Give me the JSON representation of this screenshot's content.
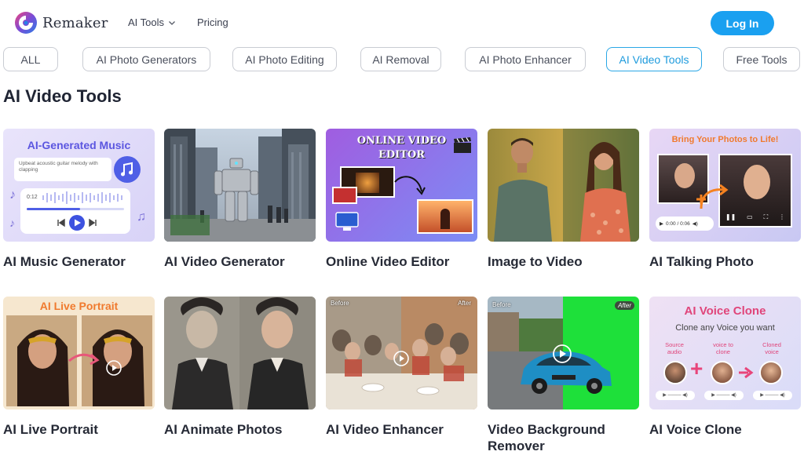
{
  "header": {
    "brand": "Remaker",
    "nav": [
      {
        "label": "AI Tools",
        "has_dropdown": true
      },
      {
        "label": "Pricing",
        "has_dropdown": false
      }
    ],
    "login_label": "Log In",
    "accent": "#1aa0f0"
  },
  "categories": [
    {
      "label": "ALL",
      "active": false
    },
    {
      "label": "AI Photo Generators",
      "active": false
    },
    {
      "label": "AI Photo Editing",
      "active": false
    },
    {
      "label": "AI Removal",
      "active": false
    },
    {
      "label": "AI Photo Enhancer",
      "active": false
    },
    {
      "label": "AI Video Tools",
      "active": true
    },
    {
      "label": "Free Tools",
      "active": false
    }
  ],
  "section_title": "AI Video Tools",
  "cards": [
    {
      "title": "AI Music Generator",
      "overlay": {
        "headline": "AI-Generated Music",
        "prompt": "Upbeat acoustic guitar melody with clapping",
        "time": "0:12"
      }
    },
    {
      "title": "AI Video Generator"
    },
    {
      "title": "Online Video Editor",
      "overlay": {
        "headline_line1": "ONLINE VIDEO",
        "headline_line2": "EDITOR"
      }
    },
    {
      "title": "Image to Video"
    },
    {
      "title": "AI Talking Photo",
      "overlay": {
        "headline": "Bring Your Photos to Life!",
        "time": "0:00 / 0:06"
      }
    },
    {
      "title": "AI Live Portrait",
      "overlay": {
        "headline": "AI Live Portrait"
      }
    },
    {
      "title": "AI Animate Photos"
    },
    {
      "title": "AI Video Enhancer",
      "overlay": {
        "before": "Before",
        "after": "After"
      }
    },
    {
      "title": "Video Background Remover",
      "overlay": {
        "before": "Before",
        "after": "After"
      }
    },
    {
      "title": "AI Voice Clone",
      "overlay": {
        "headline": "AI Voice Clone",
        "sub": "Clone any Voice you want",
        "step1": "Source audio",
        "step2": "voice to clone",
        "step3": "Cloned voice"
      }
    }
  ]
}
